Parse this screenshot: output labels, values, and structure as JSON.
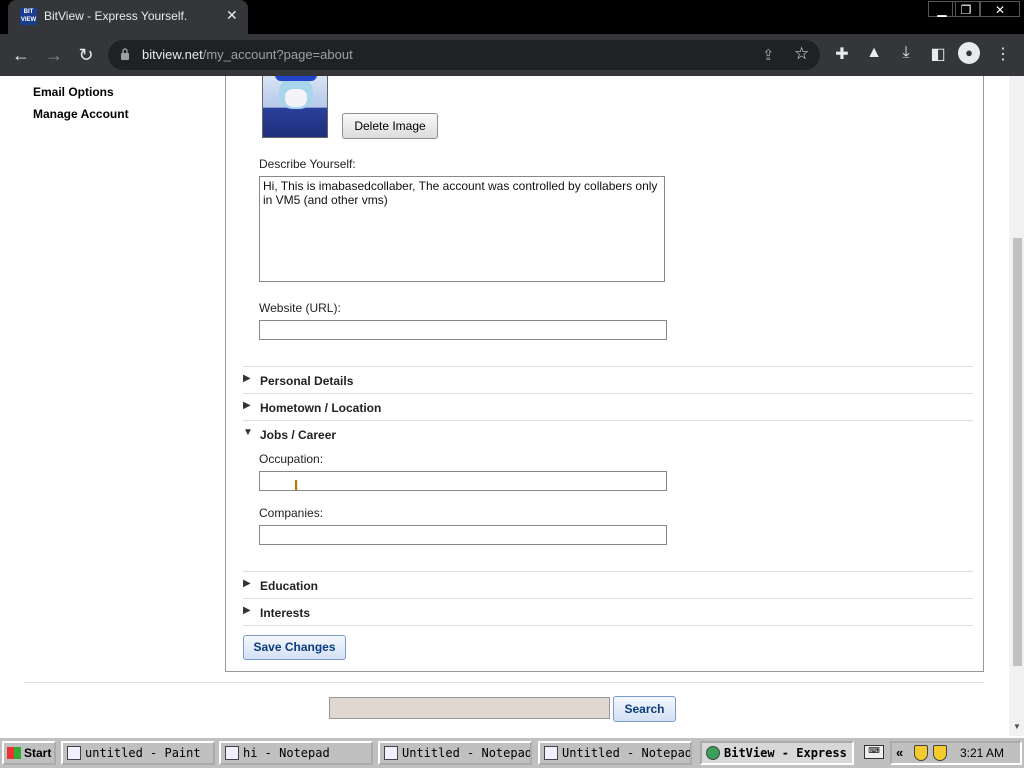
{
  "browser": {
    "tab_title": "BitView - Express Yourself.",
    "favicon_text": "BIT VIEW",
    "url_host": "bitview.net",
    "url_path": "/my_account?page=about"
  },
  "sidebar": {
    "items": [
      {
        "label": "Email Options"
      },
      {
        "label": "Manage Account"
      }
    ]
  },
  "about": {
    "delete_image_label": "Delete Image",
    "describe_label": "Describe Yourself:",
    "describe_value": "Hi, This is imabasedcollaber, The account was controlled by collabers only in VM5 (and other vms)",
    "website_label": "Website (URL):",
    "website_value": ""
  },
  "sections": [
    {
      "title": "Personal Details",
      "expanded": false
    },
    {
      "title": "Hometown / Location",
      "expanded": false
    },
    {
      "title": "Jobs / Career",
      "expanded": true
    },
    {
      "title": "Education",
      "expanded": false
    },
    {
      "title": "Interests",
      "expanded": false
    }
  ],
  "jobs": {
    "occupation_label": "Occupation:",
    "occupation_value": "",
    "companies_label": "Companies:",
    "companies_value": ""
  },
  "save_label": "Save Changes",
  "search": {
    "value": "",
    "button_label": "Search"
  },
  "taskbar": {
    "start_label": "Start",
    "tasks": [
      {
        "label": "untitled - Paint",
        "active": false
      },
      {
        "label": "hi - Notepad",
        "active": false
      },
      {
        "label": "Untitled - Notepad",
        "active": false
      },
      {
        "label": "Untitled - Notepad",
        "active": false
      },
      {
        "label": "BitView - Express ...",
        "active": true
      }
    ],
    "clock": "3:21 AM"
  },
  "icons": {
    "expanded_arrow": "down-triangle",
    "collapsed_arrow": "right-triangle"
  },
  "colors": {
    "link_blue": "#0b3c7d",
    "browser_chrome": "#35363a",
    "taskbar_gray": "#c0c0c0"
  }
}
